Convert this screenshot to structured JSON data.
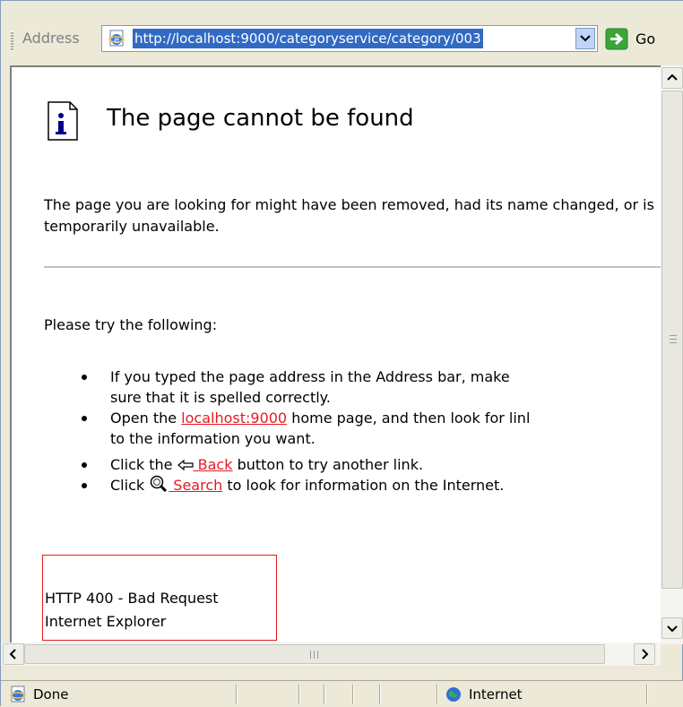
{
  "toolbar": {
    "address_label": "Address",
    "url": "http://localhost:9000/categoryservice/category/003",
    "go_label": "Go"
  },
  "page": {
    "title": "The page cannot be found",
    "intro": "The page you are looking for might have been removed, had its name changed, or is temporarily unavailable.",
    "try_heading": "Please try the following:",
    "tips": {
      "t1_line1": "If you typed the page address in the Address bar, make",
      "t1_line2": "sure that it is spelled correctly.",
      "t2_pre": "Open the ",
      "t2_link": "localhost:9000",
      "t2_post": " home page, and then look for linl",
      "t2_line2": "to the information you want.",
      "t3_pre": "Click the ",
      "t3_link": " Back",
      "t3_post": " button to try another link.",
      "t4_pre": "Click ",
      "t4_link": " Search",
      "t4_post": " to look for information on the Internet."
    },
    "error_code": "HTTP 400 - Bad Request",
    "error_source": "Internet Explorer"
  },
  "status": {
    "text": "Done",
    "zone": "Internet"
  },
  "icons": {
    "page": "ie-page-icon",
    "go": "go-arrow-icon",
    "info": "info-icon",
    "back": "back-arrow-icon",
    "search": "search-icon",
    "zone": "internet-globe-icon"
  },
  "colors": {
    "link": "#e31b23",
    "selection": "#316ac5"
  }
}
